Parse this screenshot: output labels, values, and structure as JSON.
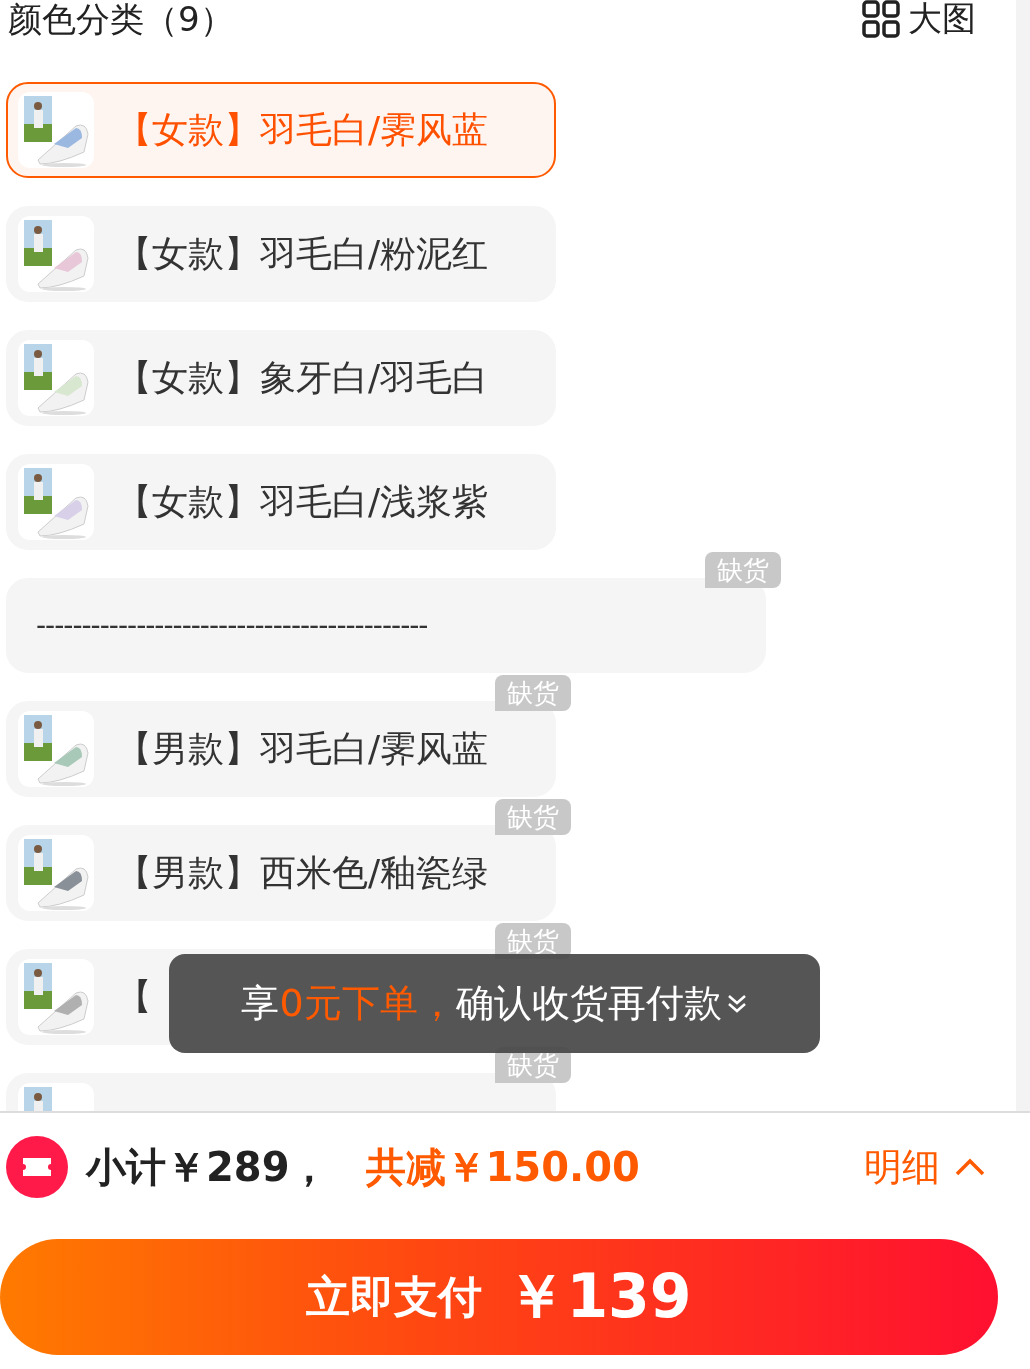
{
  "header": {
    "title": "颜色分类（9）",
    "view_toggle": "大图"
  },
  "options": [
    {
      "kind": "option",
      "label": "【女款】羽毛白/霁风蓝",
      "selected": true
    },
    {
      "kind": "option",
      "label": "【女款】羽毛白/粉泥红",
      "selected": false
    },
    {
      "kind": "option",
      "label": "【女款】象牙白/羽毛白",
      "selected": false
    },
    {
      "kind": "option",
      "label": "【女款】羽毛白/浅浆紫",
      "selected": false
    },
    {
      "kind": "separator",
      "label": "-------------------------------------------",
      "badge": "缺货",
      "selected": false
    },
    {
      "kind": "option",
      "label": "【男款】羽毛白/霁风蓝",
      "badge": "缺货",
      "selected": false
    },
    {
      "kind": "option",
      "label": "【男款】西米色/釉瓷绿",
      "badge": "缺货",
      "selected": false
    },
    {
      "kind": "option",
      "label": "【",
      "badge": "缺货",
      "selected": false
    },
    {
      "kind": "partial",
      "badge": "缺货",
      "selected": false
    }
  ],
  "toast": {
    "parts": [
      {
        "text": "享",
        "highlight": false
      },
      {
        "text": "0元下单，",
        "highlight": true
      },
      {
        "text": "确认收货再付款",
        "highlight": false
      }
    ]
  },
  "summary": {
    "subtotal": "小计￥289，",
    "discount": "共减￥150.00",
    "details": "明细"
  },
  "pay_button": {
    "label": "立即支付",
    "price": "￥139"
  }
}
